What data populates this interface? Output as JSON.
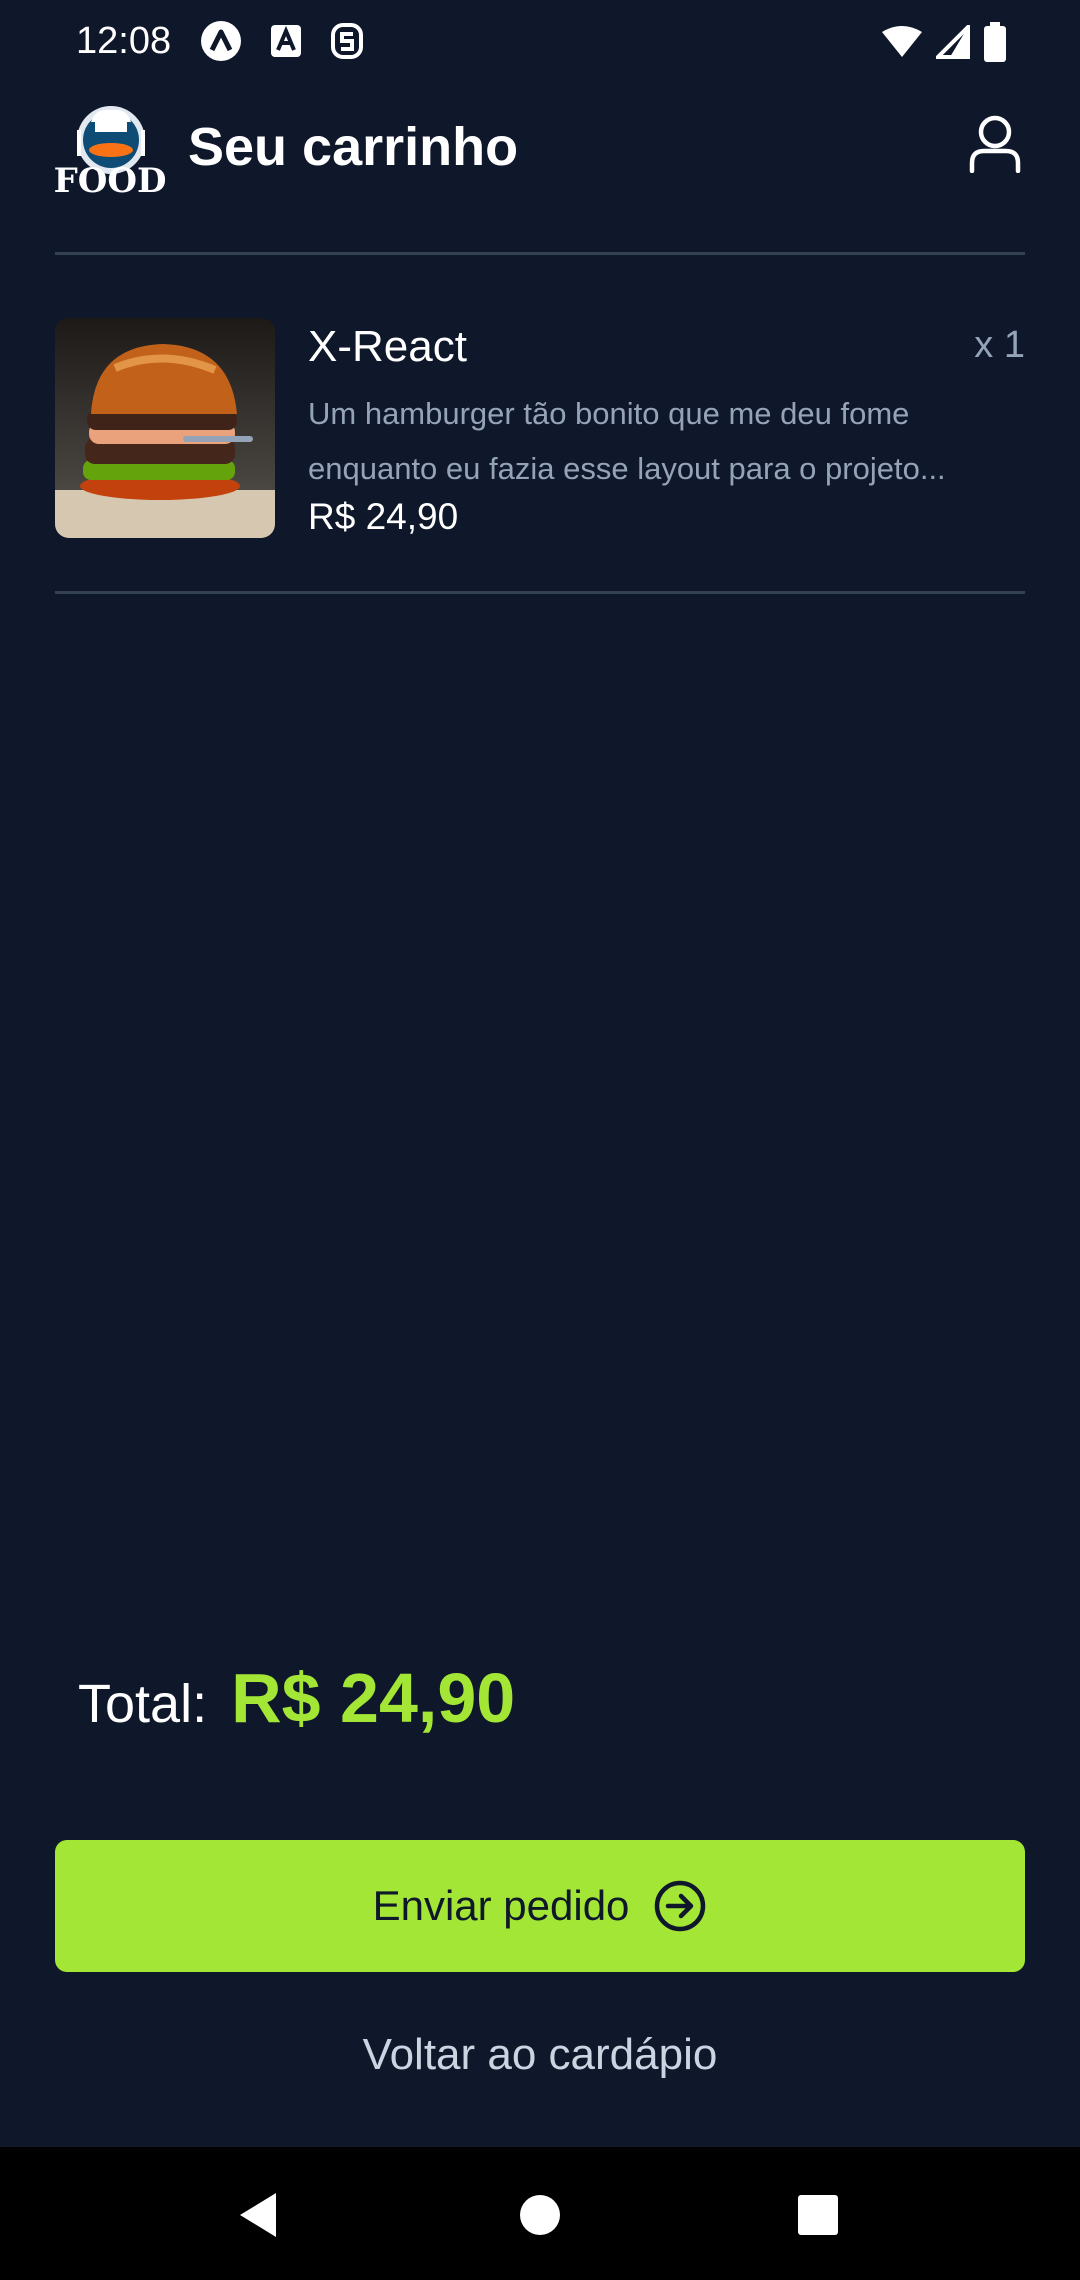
{
  "status_bar": {
    "time": "12:08"
  },
  "header": {
    "logo_text": "FOOD",
    "title": "Seu carrinho"
  },
  "cart": {
    "items": [
      {
        "name": "X-React",
        "quantity": "x 1",
        "description": "Um hamburger tão bonito que me deu fome enquanto eu fazia esse layout para o projeto...",
        "price": "R$ 24,90"
      }
    ]
  },
  "summary": {
    "total_label": "Total:",
    "total_value": "R$ 24,90"
  },
  "actions": {
    "send_label": "Enviar pedido",
    "back_label": "Voltar ao cardápio"
  },
  "icons": {
    "profile": "user-icon",
    "send": "arrow-right-circle-icon",
    "nav_back": "triangle-back-icon",
    "nav_home": "circle-home-icon",
    "nav_recents": "square-recents-icon"
  },
  "colors": {
    "background": "#0f172a",
    "accent": "#a3e635",
    "muted_text": "#94a3b8",
    "divider": "#334155"
  }
}
